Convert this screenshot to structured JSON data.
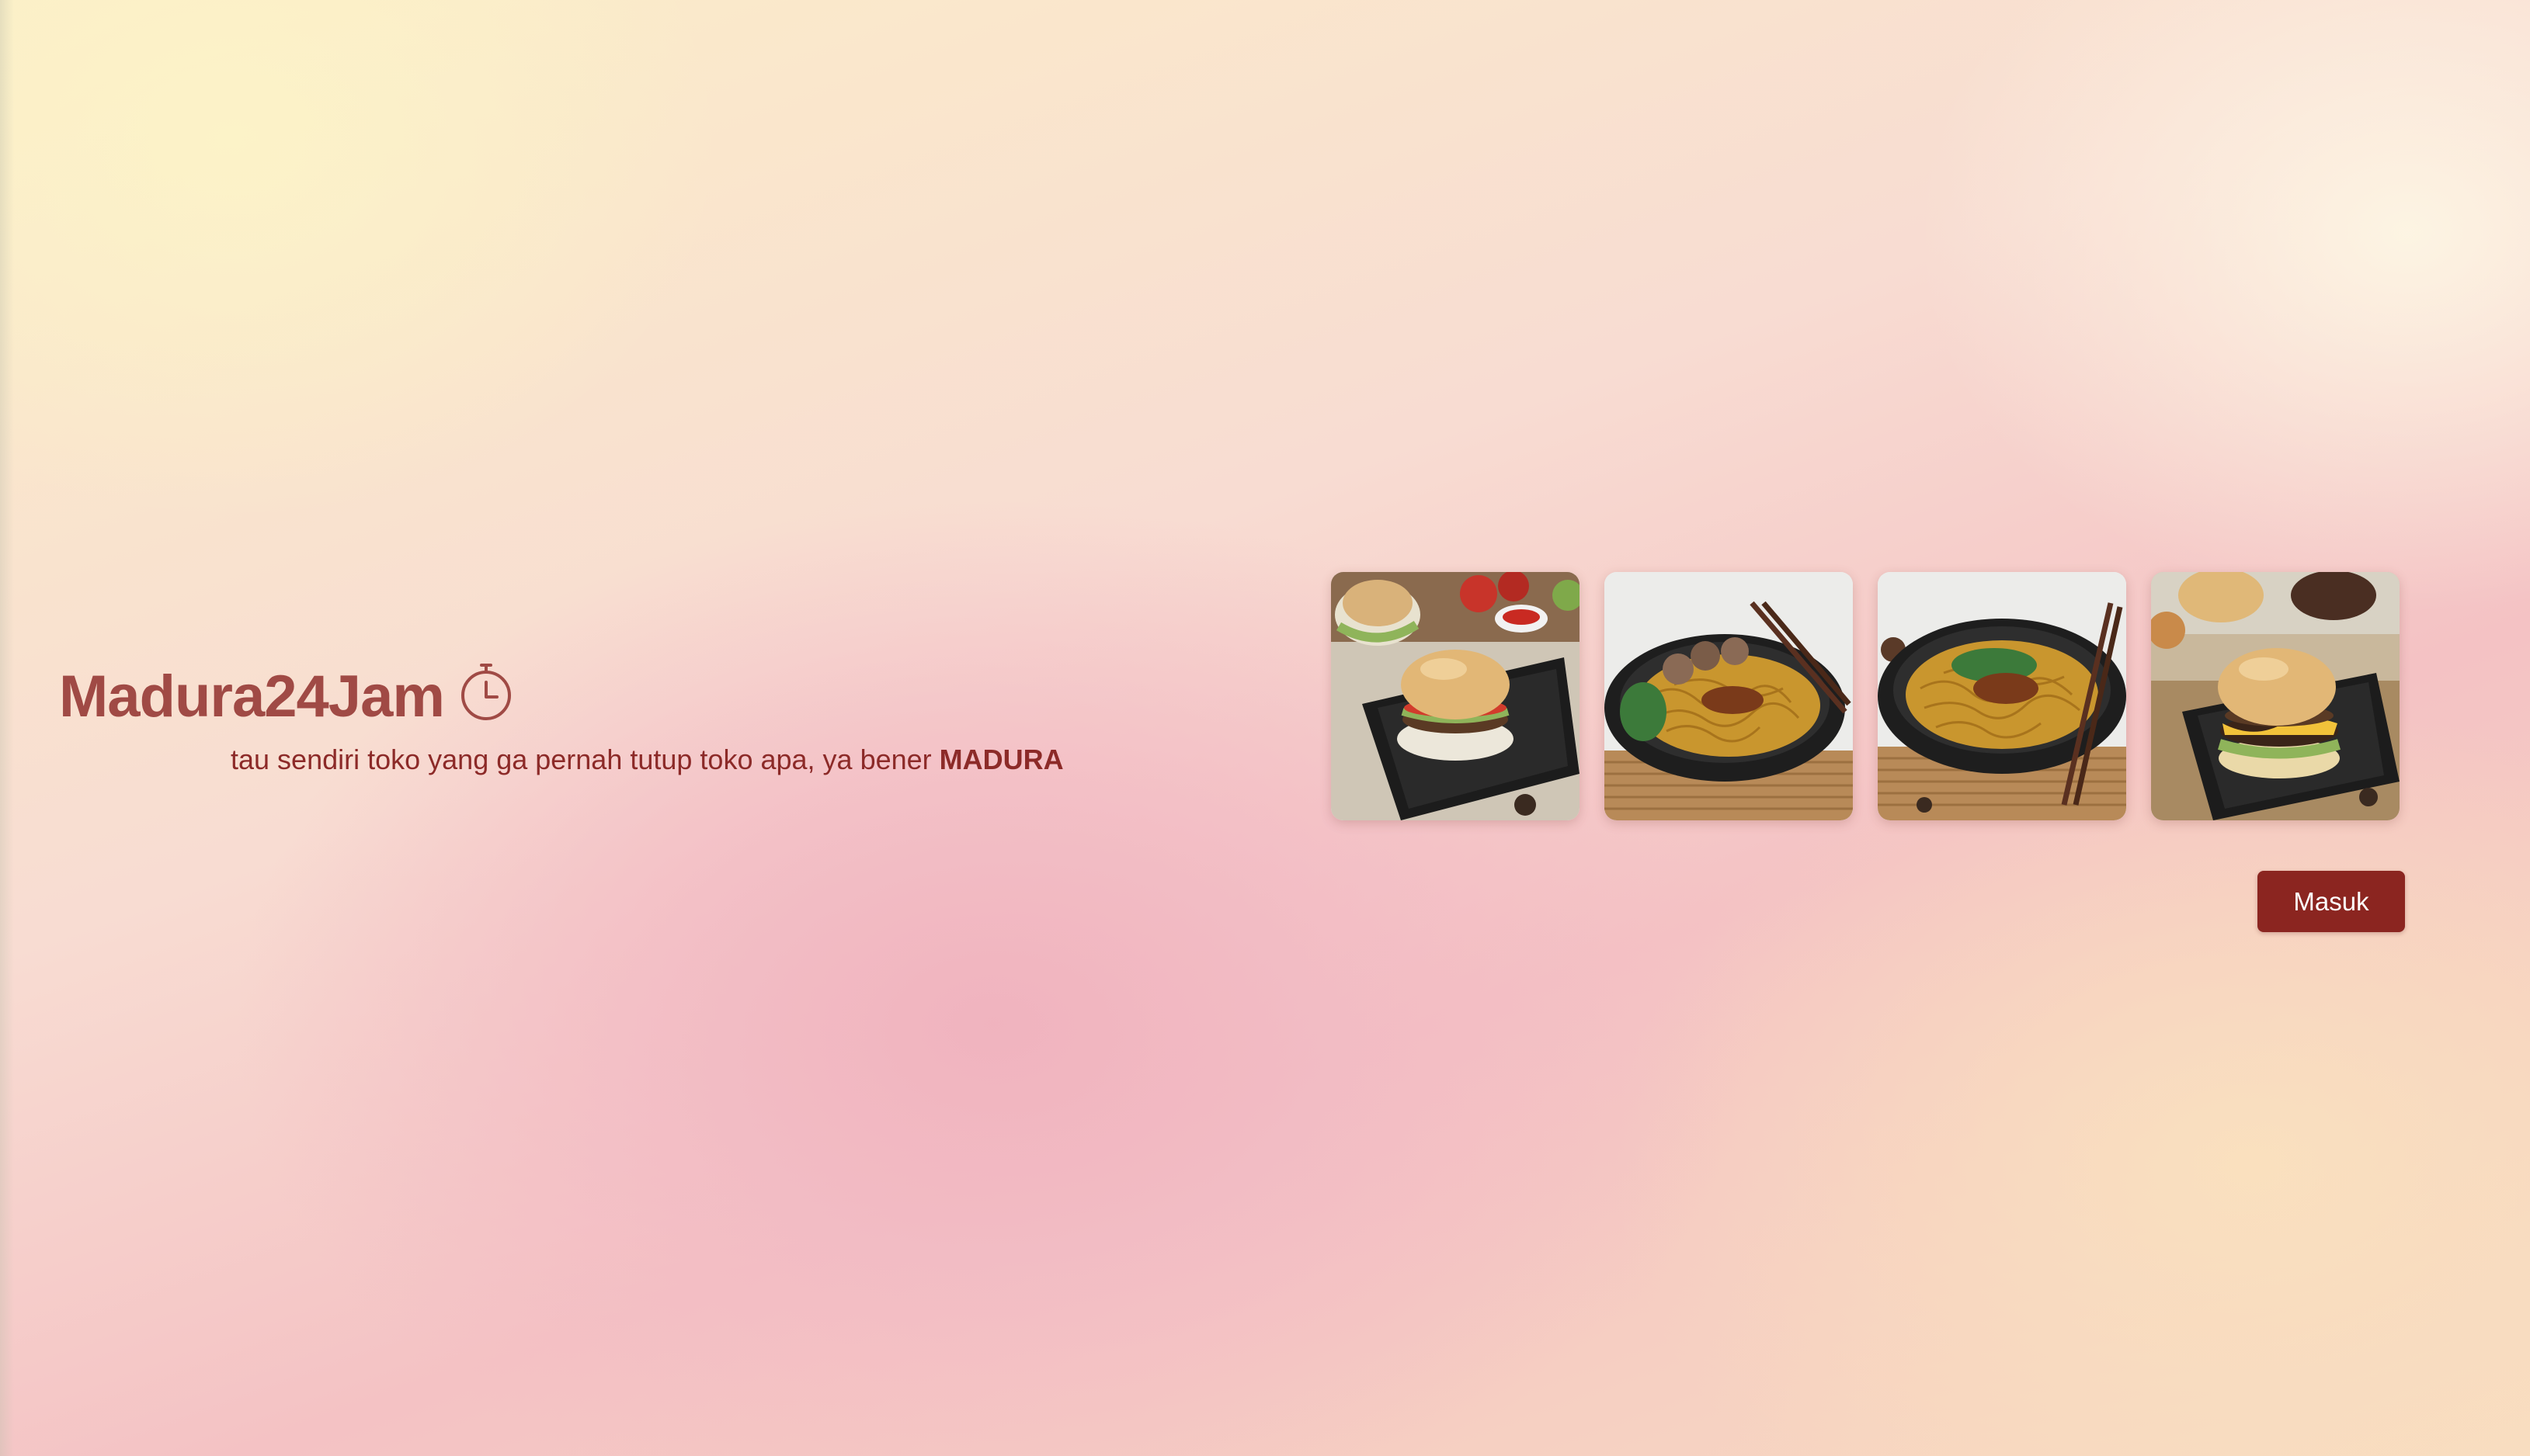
{
  "brand": {
    "title": "Madura24Jam",
    "icon": "timer-icon"
  },
  "tagline": {
    "text": "tau sendiri toko yang ga pernah tutup toko apa, ya bener ",
    "emphasis": "MADURA"
  },
  "gallery": [
    {
      "subject": "burger",
      "icon": "burger-photo"
    },
    {
      "subject": "noodle bowl with meatballs",
      "icon": "noodle-photo"
    },
    {
      "subject": "noodle bowl with chopsticks",
      "icon": "noodle-photo"
    },
    {
      "subject": "cheeseburger",
      "icon": "burger-photo"
    }
  ],
  "actions": {
    "login_label": "Masuk"
  },
  "colors": {
    "brand_text": "#a04a45",
    "tagline_text": "#8c2a28",
    "button_bg": "#8b2520",
    "button_text": "#ffffff"
  }
}
